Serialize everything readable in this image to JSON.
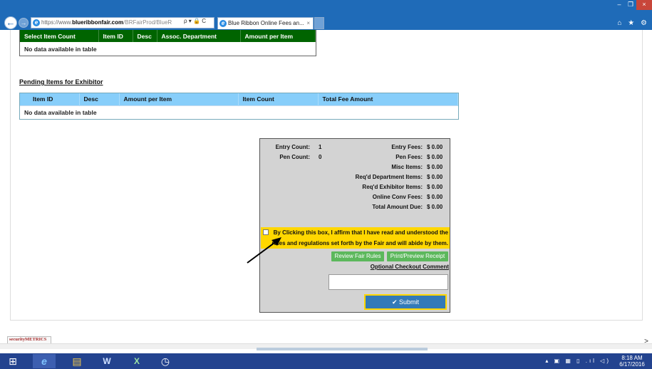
{
  "browser": {
    "address_proto": "https://www.",
    "address_domain": "blueribbonfair.com",
    "address_path": "/BRFairProd/BlueR",
    "address_controls": "ρ ▾ 🔒 C",
    "tab_title": "Blue Ribbon Online Fees an...",
    "tab_close": "×",
    "back_glyph": "←",
    "forward_glyph": "→",
    "ie_glyph": "e",
    "minimize": "–",
    "restore": "❐",
    "close": "×",
    "icons": "⌂ ★ ⚙"
  },
  "items_table": {
    "headers": [
      "Select Item Count",
      "Item ID",
      "Desc",
      "Assoc. Department",
      "Amount per Item"
    ],
    "empty_message": "No data available in table"
  },
  "pending": {
    "title": "Pending Items for Exhibitor",
    "headers": [
      "Item ID",
      "Desc",
      "Amount per Item",
      "Item Count",
      "Total Fee Amount"
    ],
    "empty_message": "No data available in table"
  },
  "summary": {
    "entry_count_label": "Entry Count:",
    "entry_count": "1",
    "pen_count_label": "Pen Count:",
    "pen_count": "0",
    "fees": [
      {
        "label": "Entry Fees:",
        "value": "$  0.00"
      },
      {
        "label": "Pen Fees:",
        "value": "$  0.00"
      },
      {
        "label": "Misc Items:",
        "value": "$  0.00"
      },
      {
        "label": "Req'd Department Items:",
        "value": "$  0.00"
      },
      {
        "label": "Req'd Exhibitor Items:",
        "value": "$  0.00"
      },
      {
        "label": "Online Conv Fees:",
        "value": "$  0.00"
      },
      {
        "label": "Total Amount Due:",
        "value": "$  0.00"
      }
    ],
    "affirm_line1": "By Clicking this box, I affirm that I have read and understood the",
    "affirm_line2": "rules and regulations set forth by the Fair and will abide by them.",
    "review_rules": "Review Fair Rules",
    "print_receipt": "Print/Preview Receipt",
    "optional_comment": "Optional Checkout Comment",
    "comment_value": "",
    "submit_check": "✔",
    "submit": "Submit"
  },
  "footer": {
    "security_badge": "securityMETRICS",
    "scroll_right": ">"
  },
  "taskbar": {
    "start_glyph": "⊞",
    "ie_glyph": "e",
    "explorer_glyph": "▤",
    "word_glyph": "W",
    "excel_glyph": "X",
    "clock_app_glyph": "◷",
    "tray_icons": "▴ ▣ ▦ ▯ .ıl ◁)",
    "time": "8:18 AM",
    "date": "6/17/2016"
  },
  "colors": {
    "items_header": "#006400",
    "pending_header": "#87cefa",
    "affirm_bg": "#ffd700",
    "button_green": "#5cb85c",
    "submit_bg": "#337ab7",
    "taskbar": "#23438f",
    "chrome": "#1f6bb8"
  }
}
